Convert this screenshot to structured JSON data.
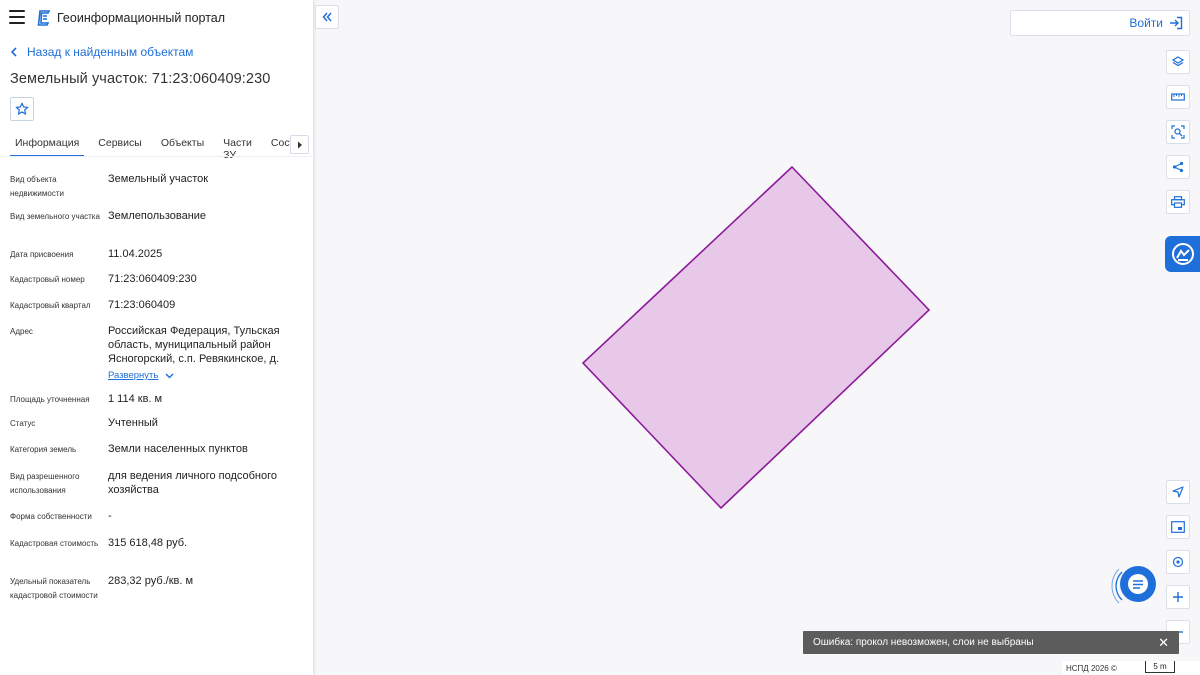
{
  "app": {
    "title": "Геоинформационный портал"
  },
  "nav": {
    "back_label": "Назад к найденным объектам"
  },
  "object": {
    "title": "Земельный участок: 71:23:060409:230"
  },
  "tabs": [
    {
      "label": "Информация",
      "active": true
    },
    {
      "label": "Сервисы",
      "active": false
    },
    {
      "label": "Объекты",
      "active": false
    },
    {
      "label": "Части ЗУ",
      "active": false
    },
    {
      "label": "Состав",
      "active": false
    }
  ],
  "properties": [
    {
      "label": "Вид объекта недвижимости",
      "value": "Земельный участок"
    },
    {
      "label": "Вид земельного участка",
      "value": "Землепользование"
    },
    {
      "label": "Дата присвоения",
      "value": "11.04.2025"
    },
    {
      "label": "Кадастровый номер",
      "value": "71:23:060409:230"
    },
    {
      "label": "Кадастровый квартал",
      "value": "71:23:060409"
    },
    {
      "label": "Адрес",
      "value": "Российская Федерация, Тульская область, муниципальный район Ясногорский, с.п. Ревякинское, д."
    },
    {
      "label": "Площадь уточненная",
      "value": "1 114 кв. м"
    },
    {
      "label": "Статус",
      "value": "Учтенный"
    },
    {
      "label": "Категория земель",
      "value": "Земли населенных пунктов"
    },
    {
      "label": "Вид разрешенного использования",
      "value": "для ведения личного подсобного хозяйства"
    },
    {
      "label": "Форма собственности",
      "value": "-"
    },
    {
      "label": "Кадастровая стоимость",
      "value": "315 618,48 руб."
    },
    {
      "label": "Удельный показатель кадастровой стоимости",
      "value": "283,32 руб./кв. м"
    }
  ],
  "address_expand_label": "Развернуть",
  "header": {
    "login_label": "Войти"
  },
  "map": {
    "parcel_fill": "#e8c8e8",
    "parcel_stroke": "#8b1a9a",
    "error_message": "Ошибка: прокол невозможен, слои не выбраны",
    "copyright": "НСПД 2026 ©",
    "scale_label": "5 m"
  },
  "colors": {
    "accent": "#1e6fd9",
    "toast_bg": "#5c5c5c"
  },
  "icons": {
    "toolbar": [
      "layers-icon",
      "ruler-icon",
      "area-select-icon",
      "share-icon",
      "print-icon"
    ],
    "bottom": [
      "navigate-icon",
      "minimap-icon",
      "geolocation-icon",
      "zoom-in-icon",
      "zoom-out-icon"
    ]
  }
}
